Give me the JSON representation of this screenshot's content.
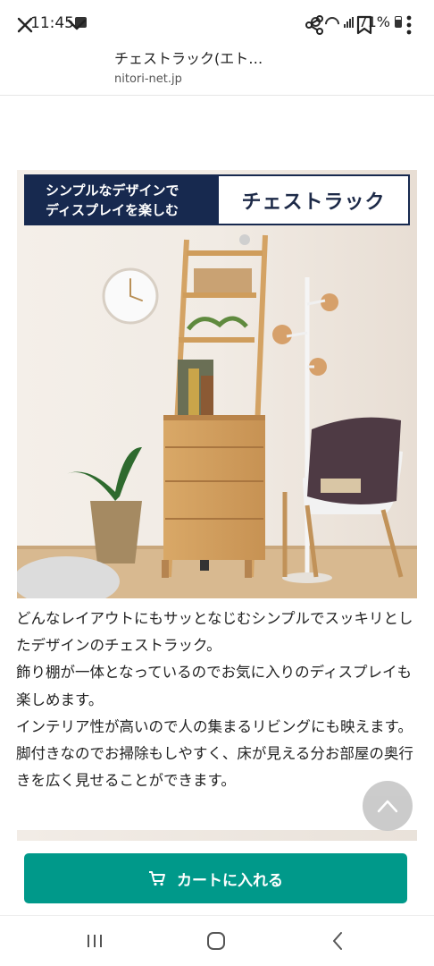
{
  "status_bar": {
    "time": "11:45",
    "battery": "71%"
  },
  "toolbar": {
    "title": "チェストラック(エト…",
    "url": "nitori-net.jp"
  },
  "banner": {
    "left_line1": "シンプルなデザインで",
    "left_line2": "ディスプレイを楽しむ",
    "right": "チェストラック",
    "color": "#17294f"
  },
  "description": [
    "どんなレイアウトにもサッとなじむシンプルでスッキリとしたデザインのチェストラック。",
    "飾り棚が一体となっているのでお気に入りのディスプレイも楽しめます。",
    "インテリア性が高いので人の集まるリビングにも映えます。",
    "脚付きなのでお掃除もしやすく、床が見える分お部屋の奥行きを広く見せることができます。"
  ],
  "cart": {
    "label": "カートに入れる",
    "color": "#00998a"
  },
  "icons": {
    "close": "close-icon",
    "chevron": "chevron-down-icon",
    "share": "share-icon",
    "bookmark": "bookmark-icon",
    "menu": "more-vert-icon",
    "cart": "cart-icon",
    "scroll_top": "chevron-up-icon",
    "recents": "recents-icon",
    "home": "home-icon",
    "back": "back-icon"
  }
}
